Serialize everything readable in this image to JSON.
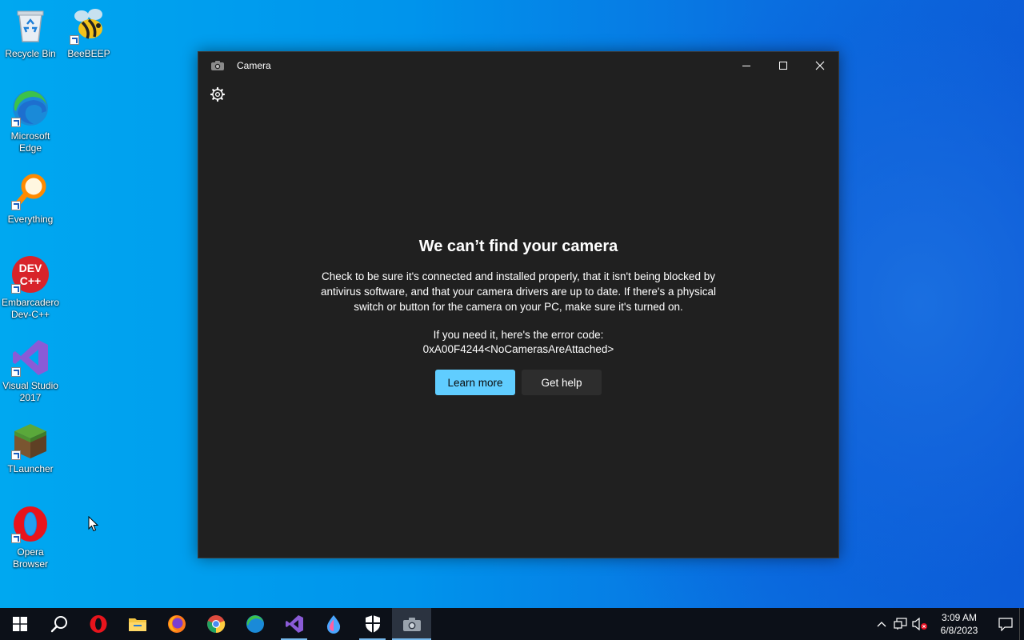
{
  "desktop": {
    "icons": [
      {
        "label": "Recycle Bin",
        "icon": "recycle-bin-icon"
      },
      {
        "label": "BeeBEEP",
        "icon": "bee-icon"
      },
      {
        "label": "Microsoft\nEdge",
        "icon": "edge-icon"
      },
      {
        "label": "Everything",
        "icon": "magnifier-icon"
      },
      {
        "label": "Embarcadero\nDev-C++",
        "icon": "devcpp-icon"
      },
      {
        "label": "Visual Studio\n2017",
        "icon": "visual-studio-icon"
      },
      {
        "label": "TLauncher",
        "icon": "grass-block-icon"
      },
      {
        "label": "Opera\nBrowser",
        "icon": "opera-icon"
      }
    ]
  },
  "window": {
    "title": "Camera",
    "heading": "We can’t find your camera",
    "body": "Check to be sure it's connected and installed properly, that it isn't being blocked by antivirus software, and that your camera drivers are up to date. If there's a physical switch or button for the camera on your PC, make sure it's turned on.",
    "error_intro": "If you need it, here's the error code:",
    "error_code": "0xA00F4244<NoCamerasAreAttached>",
    "learn_more": "Learn more",
    "get_help": "Get help",
    "accent": "#60cdff"
  },
  "taskbar": {
    "items": [
      "start-icon",
      "search-icon",
      "opera-icon",
      "file-explorer-icon",
      "firefox-icon",
      "chrome-icon",
      "edge-icon",
      "visual-studio-icon",
      "droplet-app-icon",
      "security-shield-icon",
      "camera-icon"
    ],
    "time": "3:09 AM",
    "date": "6/8/2023"
  }
}
